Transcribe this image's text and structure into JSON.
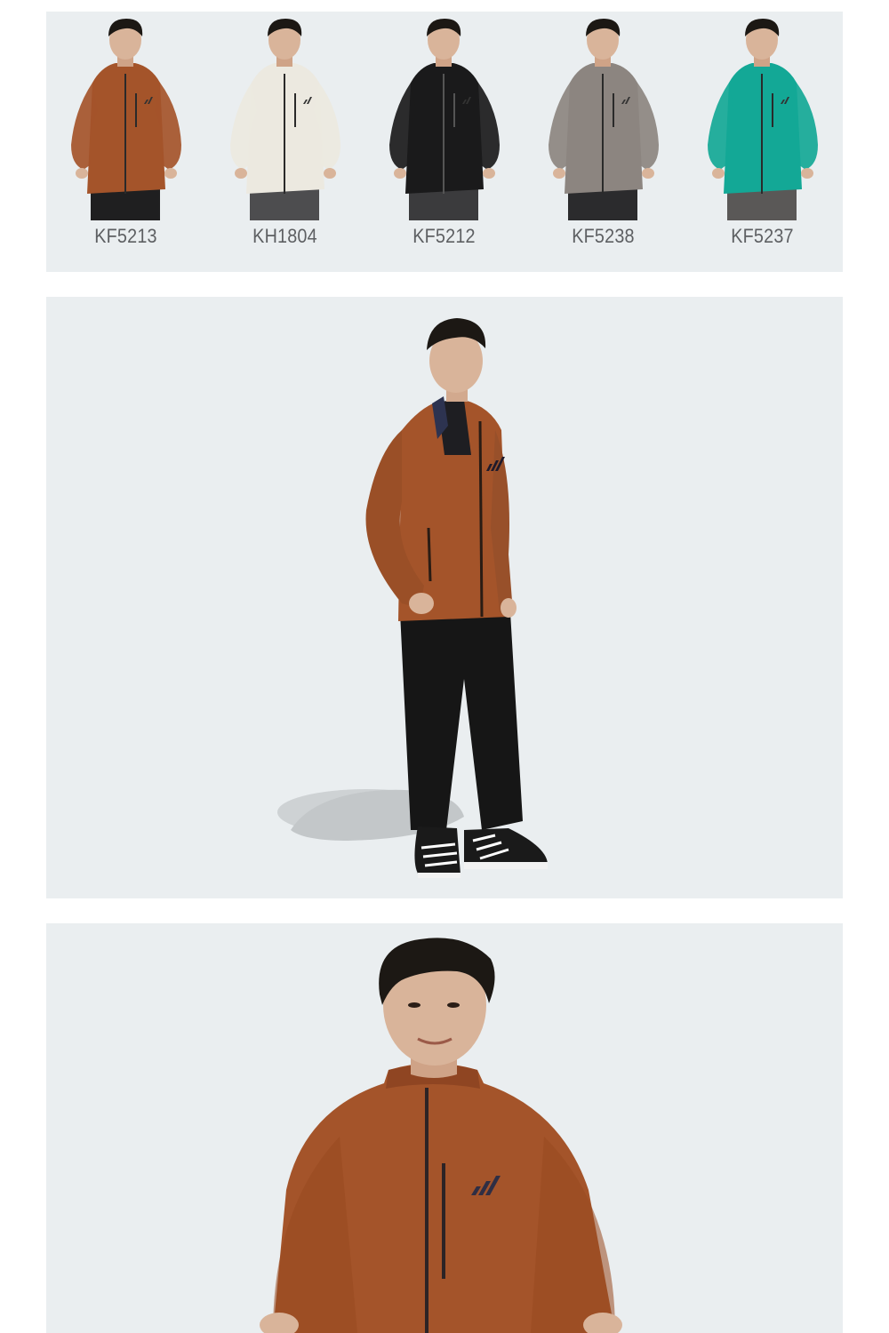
{
  "product_variants": [
    {
      "code": "KF5213",
      "color": "#a4542a",
      "pants": "#1f1f20"
    },
    {
      "code": "KH1804",
      "color": "#ece9e0",
      "pants": "#4d4d4f"
    },
    {
      "code": "KF5212",
      "color": "#1a1a1b",
      "pants": "#3b3b3d"
    },
    {
      "code": "KF5238",
      "color": "#8c8580",
      "pants": "#2b2b2d"
    },
    {
      "code": "KF5237",
      "color": "#13a896",
      "pants": "#5a5857"
    }
  ],
  "colors": {
    "panel_bg": "#eaeef0",
    "jacket_brown": "#a4542a",
    "pants_black": "#161616",
    "hair": "#1c1814",
    "skin": "#d9b49a"
  },
  "icons": [
    "adidas-logo-icon"
  ]
}
